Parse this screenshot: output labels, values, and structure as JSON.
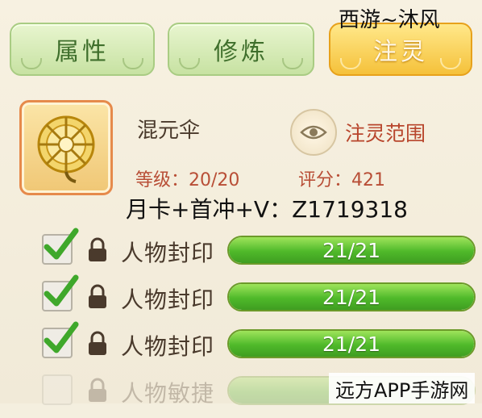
{
  "tabs": [
    {
      "label": "属性",
      "active": false
    },
    {
      "label": "修炼",
      "active": false
    },
    {
      "label": "注灵",
      "active": true
    }
  ],
  "overlay_title": "西游~沐风",
  "item": {
    "name": "混元伞",
    "icon": "golden-umbrella-icon",
    "range_button": "注灵范围",
    "level": "等级：20/20",
    "score": "评分：421"
  },
  "promo_text": "月卡+首冲+V：Z1719318",
  "rows": [
    {
      "label": "人物封印",
      "progress_text": "21/21",
      "progress": 1.0,
      "checked": true
    },
    {
      "label": "人物封印",
      "progress_text": "21/21",
      "progress": 1.0,
      "checked": true
    },
    {
      "label": "人物封印",
      "progress_text": "21/21",
      "progress": 1.0,
      "checked": true
    },
    {
      "label": "人物敏捷",
      "checked": false
    }
  ],
  "watermark": "远方APP手游网",
  "colors": {
    "accent_gold": "#f5c13a",
    "tab_green": "#c7e2a2",
    "progress_green": "#4fb92a",
    "text_red": "#b8452c"
  }
}
